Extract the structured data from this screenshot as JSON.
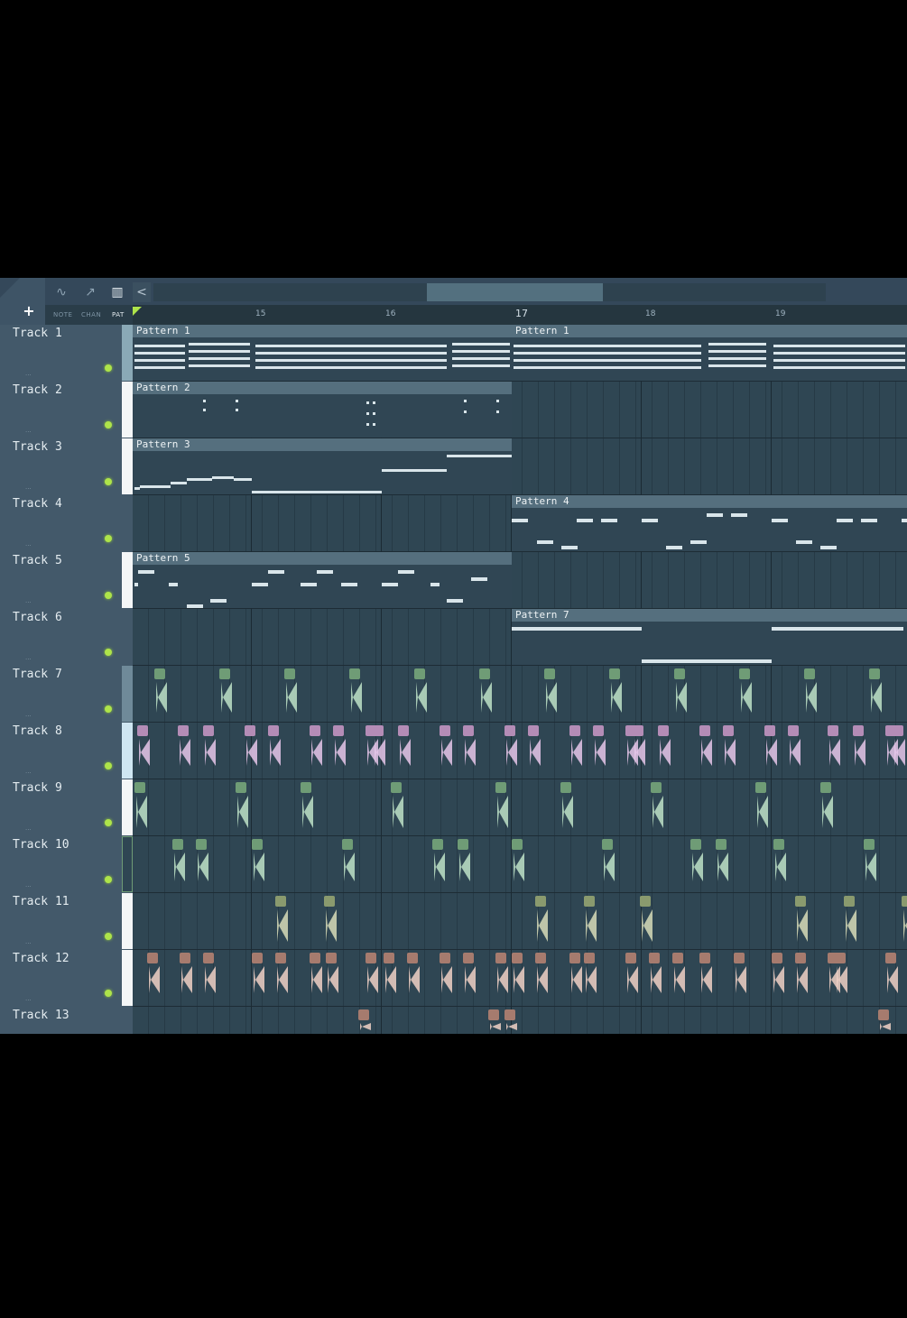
{
  "toolbar": {
    "add_label": "+",
    "modes": [
      {
        "label": "NOTE",
        "icon": "waveform-icon"
      },
      {
        "label": "CHAN",
        "icon": "automation-icon"
      },
      {
        "label": "PAT",
        "icon": "piano-icon"
      }
    ],
    "scroll_left_label": "<"
  },
  "ruler": {
    "bars": [
      "15",
      "16",
      "17",
      "18",
      "19"
    ],
    "current_bar": "17"
  },
  "tracks": [
    {
      "name": "Track 1"
    },
    {
      "name": "Track 2"
    },
    {
      "name": "Track 3"
    },
    {
      "name": "Track 4"
    },
    {
      "name": "Track 5"
    },
    {
      "name": "Track 6"
    },
    {
      "name": "Track 7"
    },
    {
      "name": "Track 8"
    },
    {
      "name": "Track 9"
    },
    {
      "name": "Track 10"
    },
    {
      "name": "Track 11"
    },
    {
      "name": "Track 12"
    },
    {
      "name": "Track 13"
    }
  ],
  "clips": {
    "t1a": "Pattern 1",
    "t1b": "Pattern 1",
    "t2": "Pattern 2",
    "t3": "Pattern 3",
    "t4": "Pattern 4",
    "t5": "Pattern 5",
    "t6": "Pattern 7"
  },
  "colors": {
    "accent": "#aee44a",
    "track7": "#6f9c76",
    "track8": "#b48cb6",
    "track9": "#6f9c76",
    "track10": "#6f9c76",
    "track11": "#8a9a6e",
    "track12": "#a67b6e",
    "track13": "#a67b6e"
  }
}
